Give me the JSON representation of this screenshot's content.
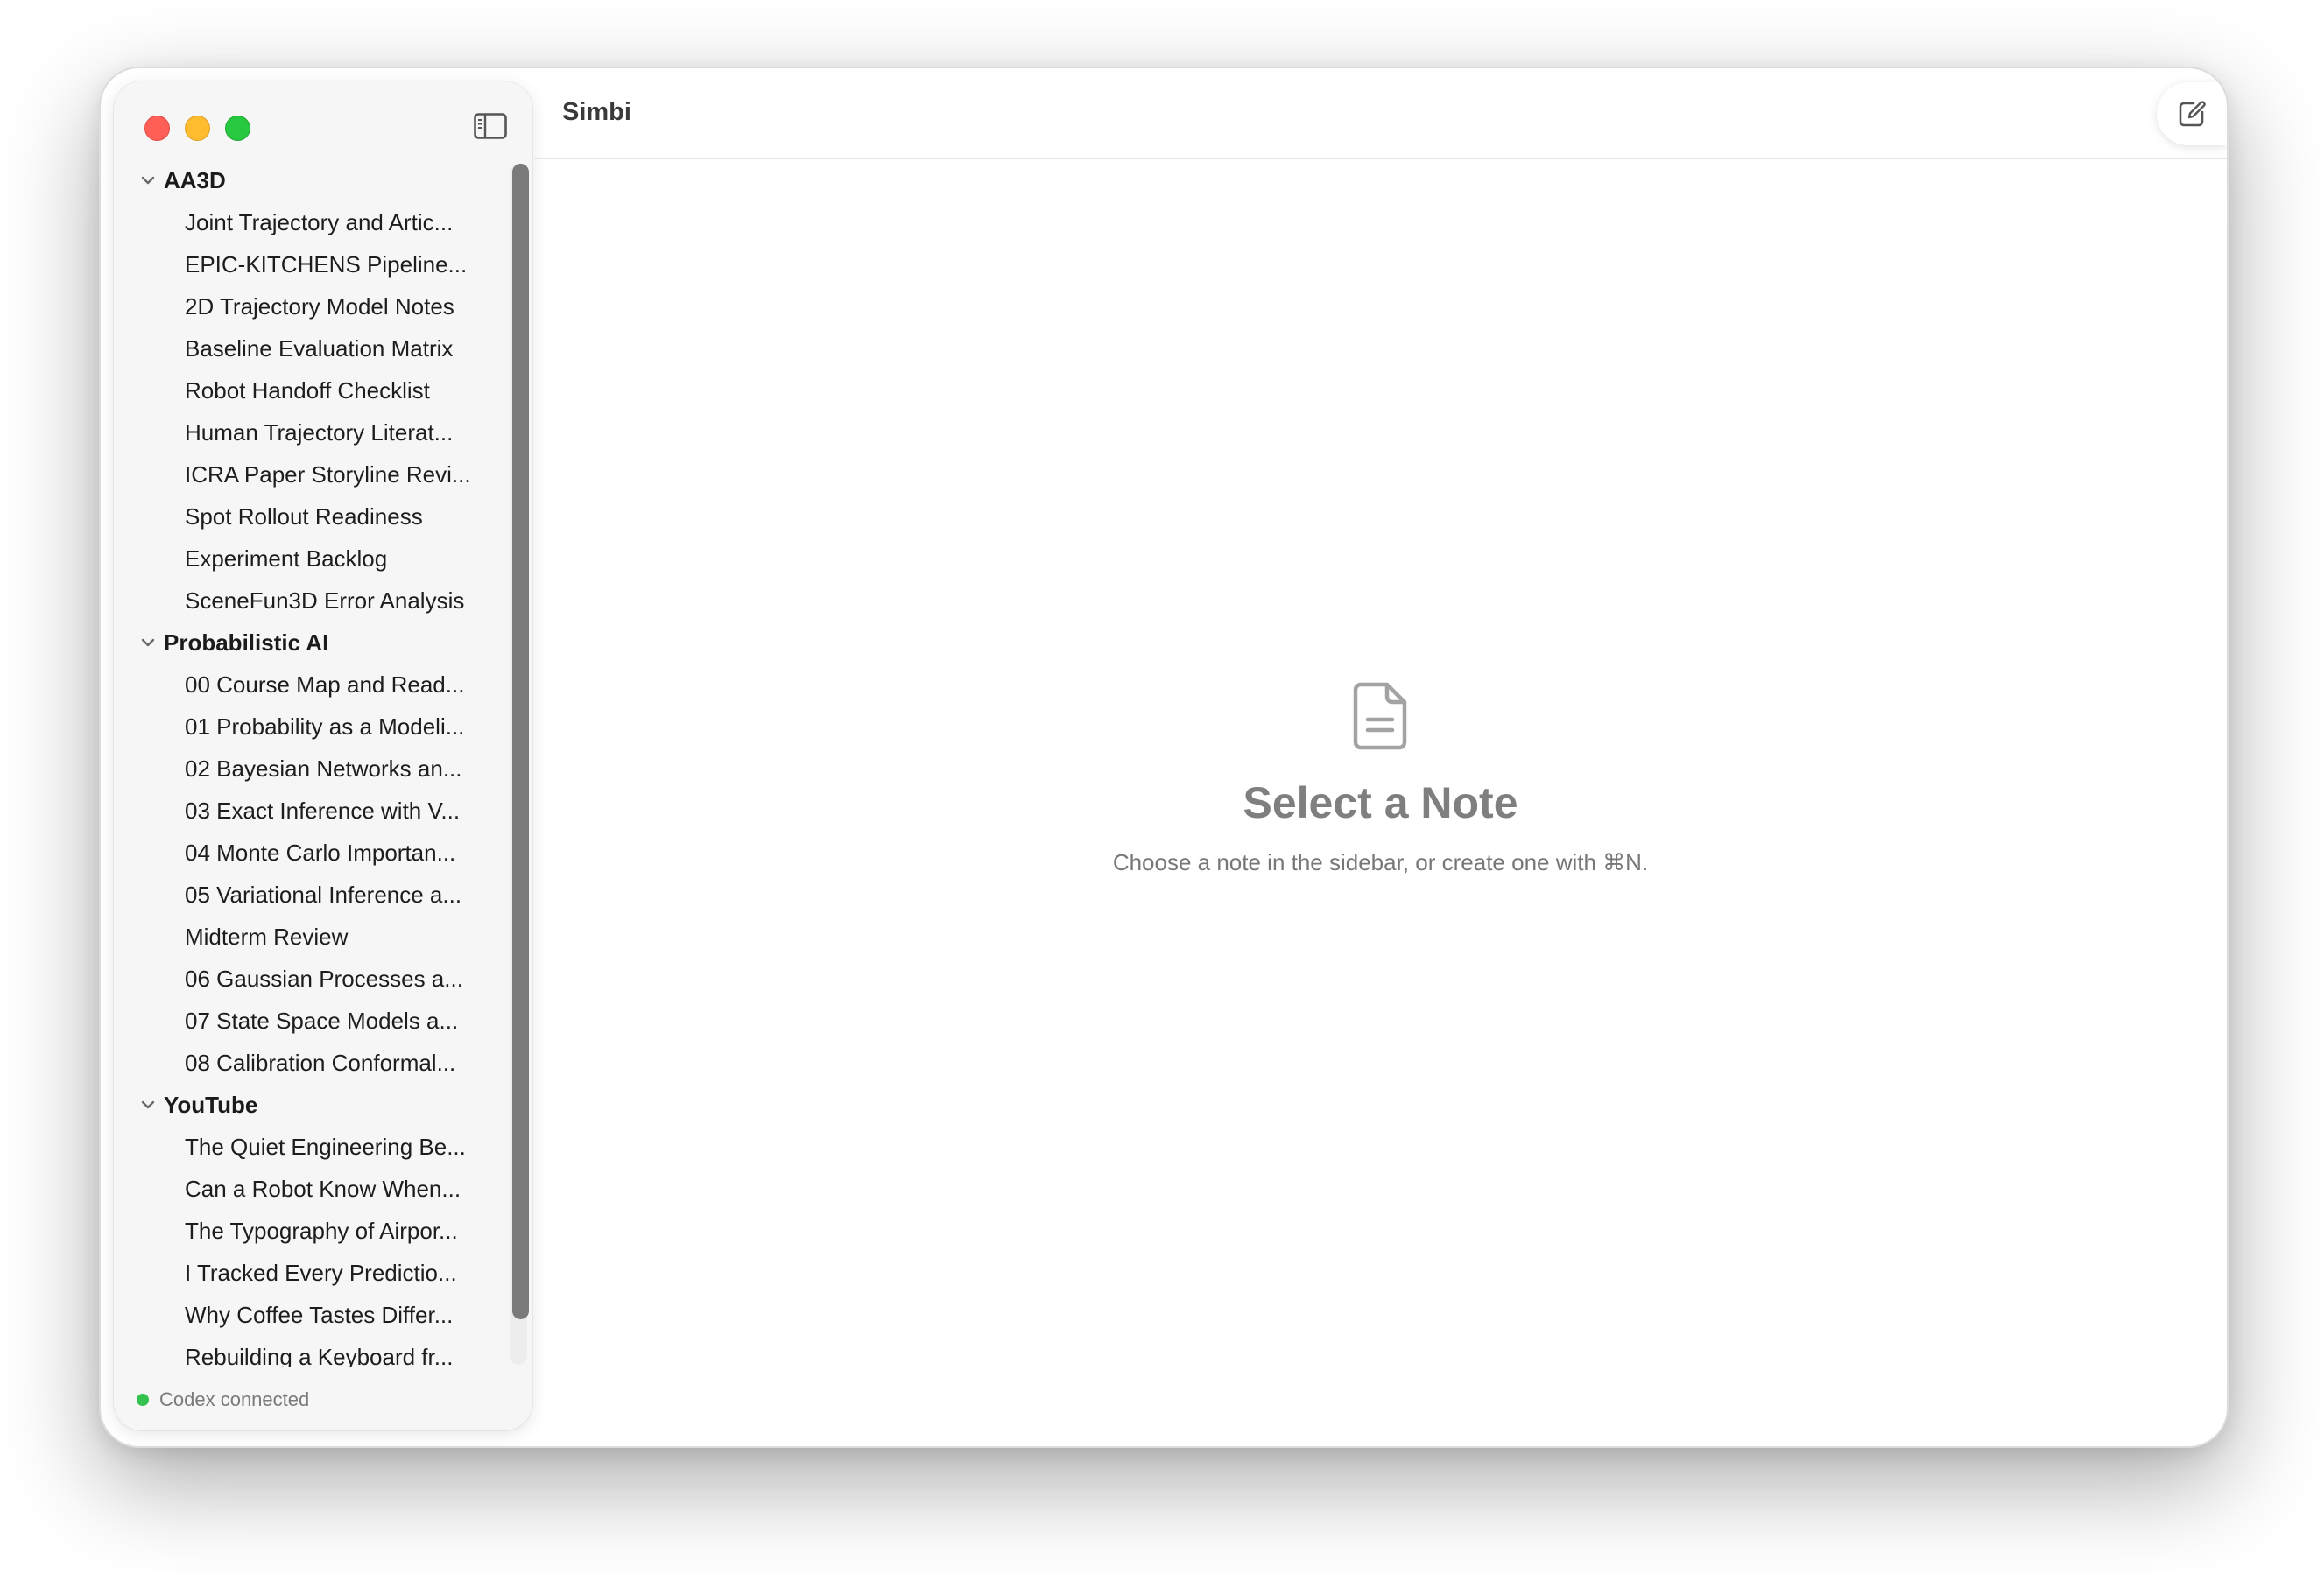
{
  "app": {
    "title": "Simbi"
  },
  "sidebar": {
    "groups": [
      {
        "label": "AA3D",
        "items": [
          "Joint Trajectory and Artic...",
          "EPIC-KITCHENS Pipeline...",
          "2D Trajectory Model Notes",
          "Baseline Evaluation Matrix",
          "Robot Handoff Checklist",
          "Human Trajectory Literat...",
          "ICRA Paper Storyline Revi...",
          "Spot Rollout Readiness",
          "Experiment Backlog",
          "SceneFun3D Error Analysis"
        ]
      },
      {
        "label": "Probabilistic AI",
        "items": [
          "00 Course Map and Read...",
          "01 Probability as a Modeli...",
          "02 Bayesian Networks an...",
          "03 Exact Inference with V...",
          "04 Monte Carlo Importan...",
          "05 Variational Inference a...",
          "Midterm Review",
          "06 Gaussian Processes a...",
          "07 State Space Models a...",
          "08 Calibration Conformal..."
        ]
      },
      {
        "label": "YouTube",
        "items": [
          "The Quiet Engineering Be...",
          "Can a Robot Know When...",
          "The Typography of Airpor...",
          "I Tracked Every Predictio...",
          "Why Coffee Tastes Differ...",
          "Rebuilding a Keyboard fr..."
        ]
      }
    ],
    "status": {
      "text": "Codex connected",
      "color": "#32c24d"
    }
  },
  "empty_state": {
    "title": "Select a Note",
    "subtitle": "Choose a note in the sidebar, or create one with ⌘N."
  },
  "icons": {
    "traffic": [
      "close-icon",
      "minimize-icon",
      "zoom-icon"
    ],
    "toolbar": [
      "sidebar-toggle-icon",
      "compose-icon"
    ],
    "empty": "document-icon",
    "group": "chevron-down-icon"
  }
}
